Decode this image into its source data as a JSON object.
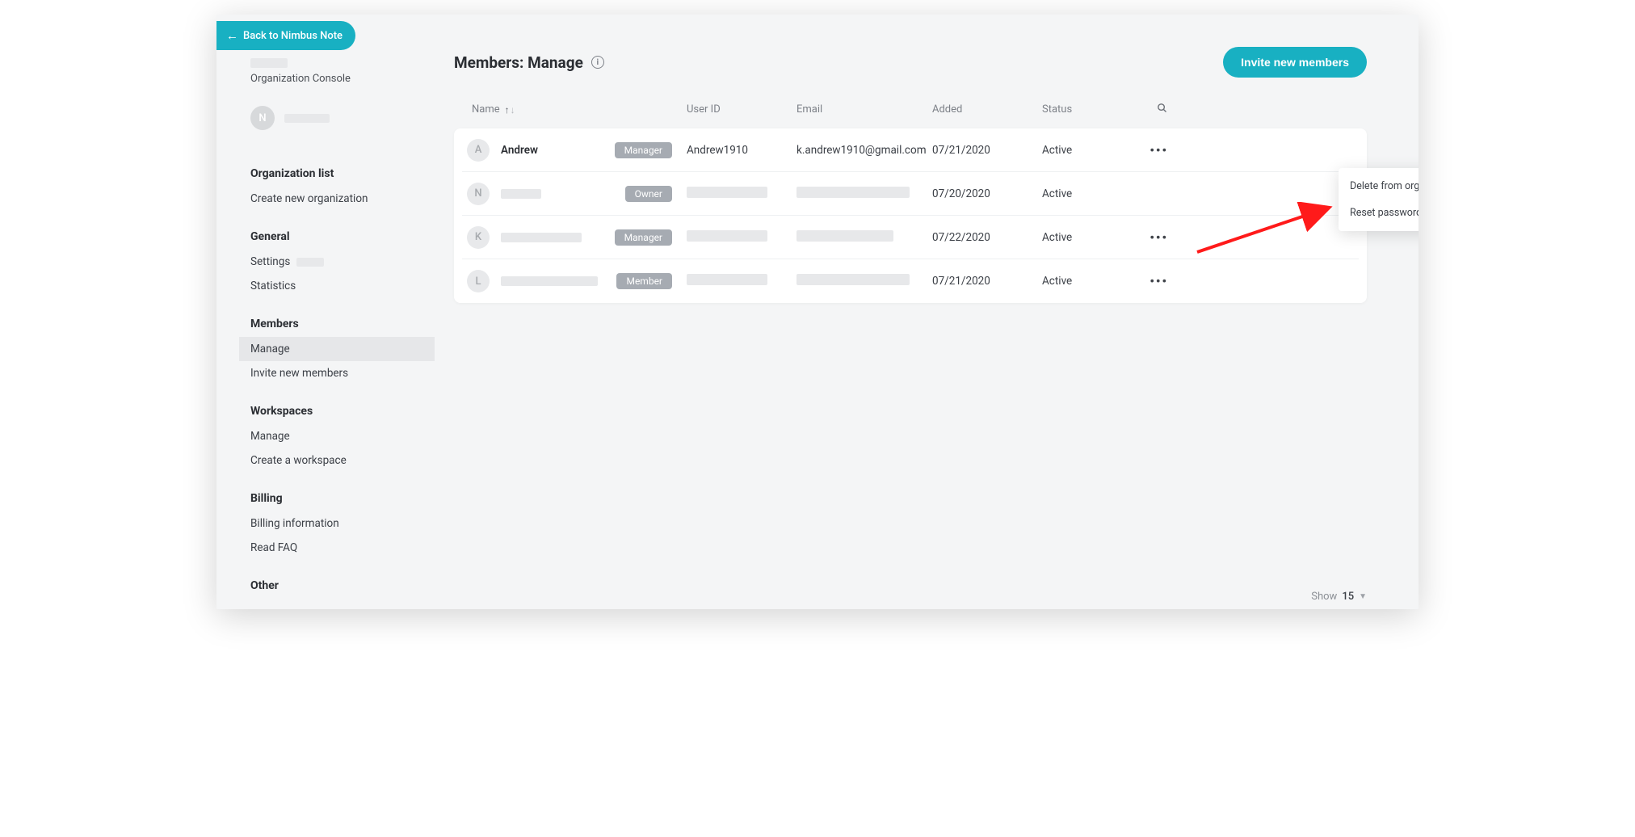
{
  "back_button": "Back to Nimbus Note",
  "console_label": "Organization Console",
  "user_avatar_letter": "N",
  "sidebar": {
    "org": {
      "title": "Organization list",
      "items": [
        "Create new organization"
      ]
    },
    "general": {
      "title": "General",
      "items": [
        "Settings",
        "Statistics"
      ]
    },
    "members": {
      "title": "Members",
      "items": [
        "Manage",
        "Invite new members"
      ],
      "active_index": 0
    },
    "workspaces": {
      "title": "Workspaces",
      "items": [
        "Manage",
        "Create a workspace"
      ]
    },
    "billing": {
      "title": "Billing",
      "items": [
        "Billing information",
        "Read FAQ"
      ]
    },
    "other": {
      "title": "Other",
      "items": []
    }
  },
  "page": {
    "title": "Members: Manage",
    "invite_button": "Invite new members"
  },
  "columns": {
    "name": "Name",
    "user_id": "User ID",
    "email": "Email",
    "added": "Added",
    "status": "Status"
  },
  "rows": [
    {
      "avatar": "A",
      "name": "Andrew",
      "role": "Manager",
      "user_id": "Andrew1910",
      "email": "k.andrew1910@gmail.com",
      "added": "07/21/2020",
      "status": "Active",
      "redacted": false
    },
    {
      "avatar": "N",
      "name": "",
      "role": "Owner",
      "user_id": "",
      "email": "",
      "added": "07/20/2020",
      "status": "Active",
      "redacted": true
    },
    {
      "avatar": "K",
      "name": "",
      "role": "Manager",
      "user_id": "",
      "email": "",
      "added": "07/22/2020",
      "status": "Active",
      "redacted": true
    },
    {
      "avatar": "L",
      "name": "",
      "role": "Member",
      "user_id": "",
      "email": "",
      "added": "07/21/2020",
      "status": "Active",
      "redacted": true
    }
  ],
  "dropdown": {
    "delete": "Delete from organization",
    "reset": "Reset password"
  },
  "footer": {
    "show_label": "Show",
    "page_size": "15"
  }
}
